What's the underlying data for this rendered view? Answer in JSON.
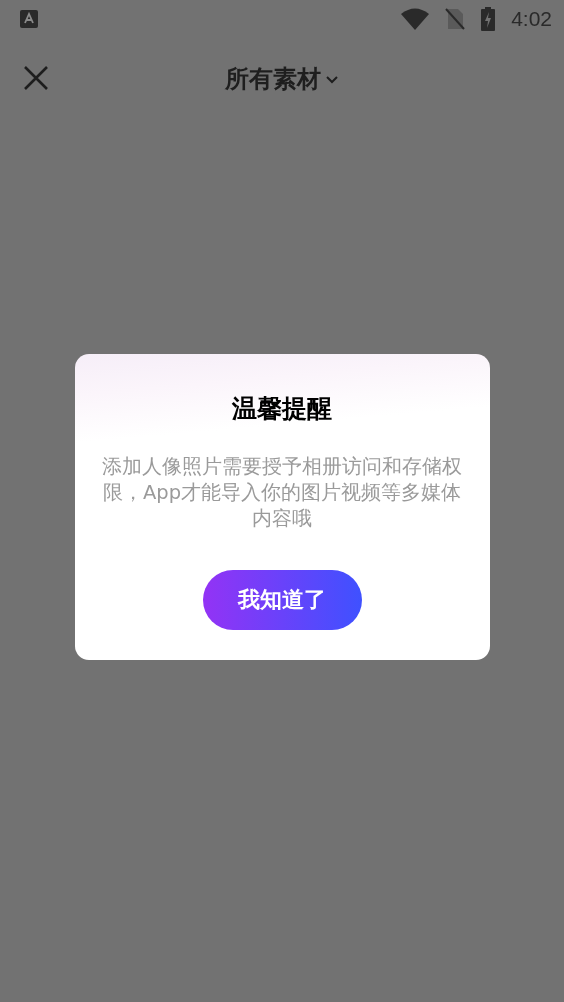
{
  "status_bar": {
    "time": "4:02"
  },
  "header": {
    "title": "所有素材"
  },
  "dialog": {
    "title": "温馨提醒",
    "message": "添加人像照片需要授予相册访问和存储权限，App才能导入你的图片视频等多媒体内容哦",
    "button": "我知道了"
  }
}
